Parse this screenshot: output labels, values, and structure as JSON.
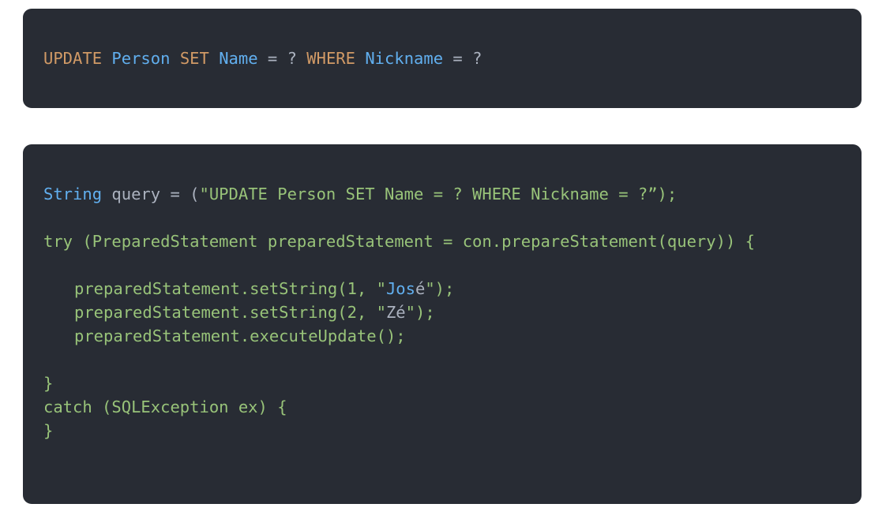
{
  "sql_block": {
    "tokens": [
      {
        "text": "UPDATE",
        "role": "keyword"
      },
      {
        "text": " ",
        "role": "space"
      },
      {
        "text": "Person",
        "role": "identifier"
      },
      {
        "text": " ",
        "role": "space"
      },
      {
        "text": "SET",
        "role": "keyword"
      },
      {
        "text": " ",
        "role": "space"
      },
      {
        "text": "Name",
        "role": "identifier"
      },
      {
        "text": " = ? ",
        "role": "operator"
      },
      {
        "text": "WHERE",
        "role": "keyword"
      },
      {
        "text": " ",
        "role": "space"
      },
      {
        "text": "Nickname",
        "role": "identifier"
      },
      {
        "text": " = ?",
        "role": "operator"
      }
    ]
  },
  "java_block": {
    "line1": {
      "type": "String",
      "var": " query = (",
      "string": "\"UPDATE Person SET Name = ? WHERE Nickname = ?”);"
    },
    "line2": "try (PreparedStatement preparedStatement = con.prepareStatement(query)) {",
    "line3": {
      "a": "preparedStatement.setString(1, \"",
      "b": "Jos",
      "c": "é",
      "d": "\");"
    },
    "line4": {
      "a": "preparedStatement.setString(2, \"",
      "b": "Zé",
      "c": "\");"
    },
    "line5": "preparedStatement.executeUpdate();",
    "line6": "}",
    "line7": "catch (SQLException ex) {",
    "line8": "}"
  },
  "colors": {
    "background": "#282c34",
    "keyword": "#d19a66",
    "identifier": "#61afef",
    "string": "#98c379",
    "plain": "#abb2bf"
  }
}
